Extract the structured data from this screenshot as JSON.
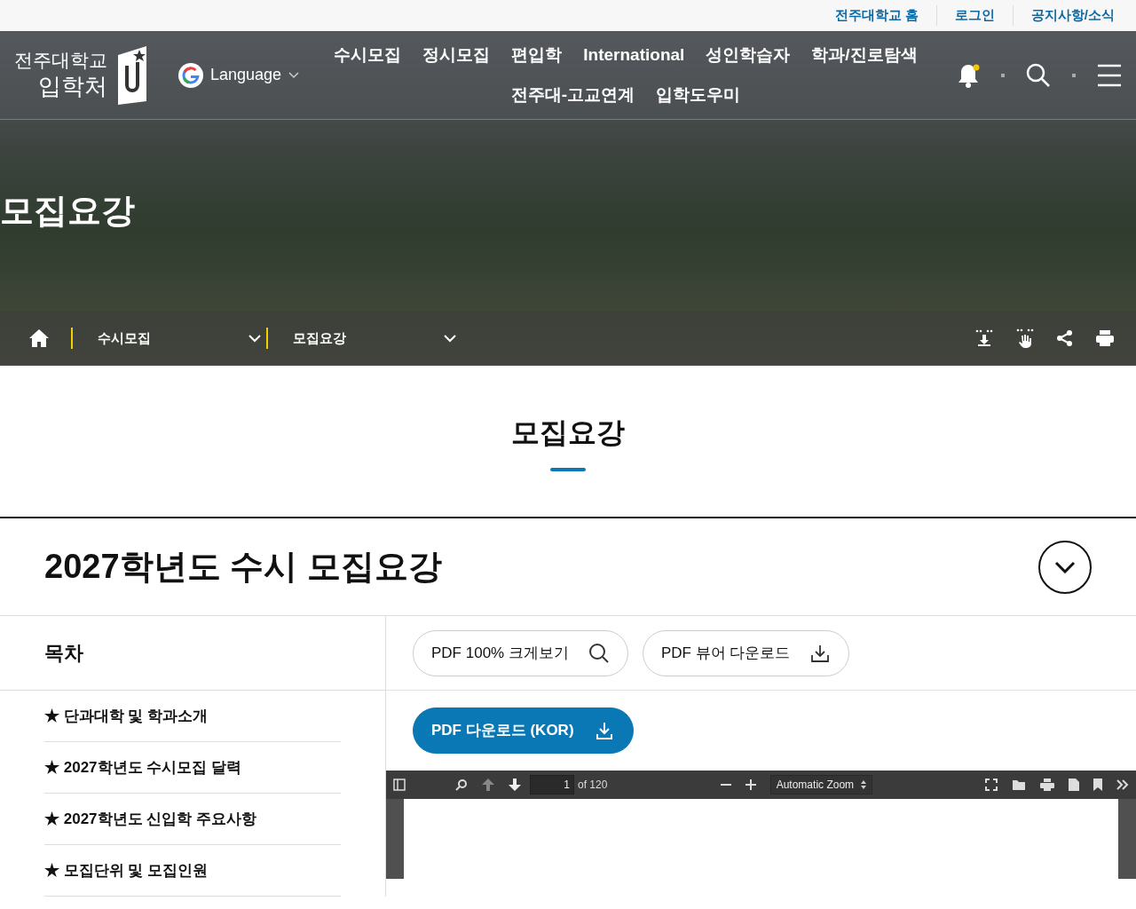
{
  "top_links": [
    "전주대학교 홈",
    "로그인",
    "공지사항/소식"
  ],
  "logo": {
    "line1": "전주대학교",
    "line2": "입학처"
  },
  "language": "Language",
  "main_nav": [
    [
      "수시모집",
      "정시모집",
      "편입학",
      "International",
      "성인학습자",
      "학과/진로탐색"
    ],
    [
      "전주대-고교연계",
      "입학도우미"
    ]
  ],
  "notification": {
    "unread": true
  },
  "hero": {
    "title": "모집요강"
  },
  "breadcrumb": [
    "수시모집",
    "모집요강"
  ],
  "page_title": "모집요강",
  "section_title": "2027학년도 수시 모집요강",
  "toc": {
    "heading": "목차",
    "items": [
      "★ 단과대학 및 학과소개",
      "★ 2027학년도 수시모집 달력",
      "★ 2027학년도 신입학 주요사항",
      "★ 모집단위 및 모집인원"
    ]
  },
  "buttons": [
    [
      {
        "label": "PDF 100% 크게보기",
        "kind": "zoom"
      },
      {
        "label": "PDF 뷰어 다운로드",
        "kind": "download"
      }
    ],
    [
      {
        "label": "PDF 다운로드 (KOR)",
        "kind": "primary"
      }
    ]
  ],
  "pdf_viewer": {
    "page": "1",
    "page_count": "of 120",
    "zoom": "Automatic Zoom"
  }
}
